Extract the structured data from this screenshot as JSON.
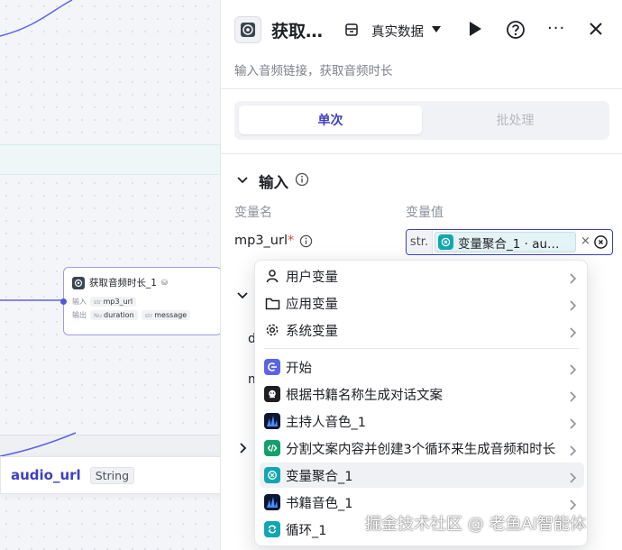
{
  "canvas": {
    "node": {
      "title": "获取音频时长_1",
      "input_label": "输入",
      "input_type": "str",
      "input_name": "mp3_url",
      "output_label": "输出",
      "output1_type": "Nu",
      "output1_name": "duration",
      "output2_type": "str",
      "output2_name": "message"
    },
    "field": {
      "name": "audio_url",
      "type": "String"
    }
  },
  "panel": {
    "title": "获取…",
    "data_mode": "真实数据",
    "more": "···",
    "description": "输入音频链接，获取音频时长",
    "tabs": {
      "single": "单次",
      "batch": "批处理"
    },
    "input_section": {
      "title": "输入",
      "col_name": "变量名",
      "col_value": "变量值",
      "var_name": "mp3_url",
      "required_mark": "*",
      "value_type": "str.",
      "value_ref": "变量聚合_1 · au…",
      "clear": "×"
    },
    "hidden_rows": {
      "r1": "d",
      "r2": "m"
    }
  },
  "menu": {
    "items": [
      {
        "label": "用户变量",
        "icon": "user-icon"
      },
      {
        "label": "应用变量",
        "icon": "folder-icon"
      },
      {
        "label": "系统变量",
        "icon": "gear-icon"
      },
      {
        "label": "开始",
        "icon": "start-icon"
      },
      {
        "label": "根据书籍名称生成对话文案",
        "icon": "llm-icon"
      },
      {
        "label": "主持人音色_1",
        "icon": "voice-icon"
      },
      {
        "label": "分割文案内容并创建3个循环来生成音频和时长",
        "icon": "code-icon"
      },
      {
        "label": "变量聚合_1",
        "icon": "aggregate-icon"
      },
      {
        "label": "书籍音色_1",
        "icon": "voice-icon"
      },
      {
        "label": "循环_1",
        "icon": "loop-icon"
      }
    ]
  },
  "watermark": "掘金技术社区 @ 老鱼AI智能体",
  "colors": {
    "accent": "#3d3fc3",
    "teal": "#12a6b0",
    "start": "#5b64e6",
    "code": "#14a06b"
  }
}
